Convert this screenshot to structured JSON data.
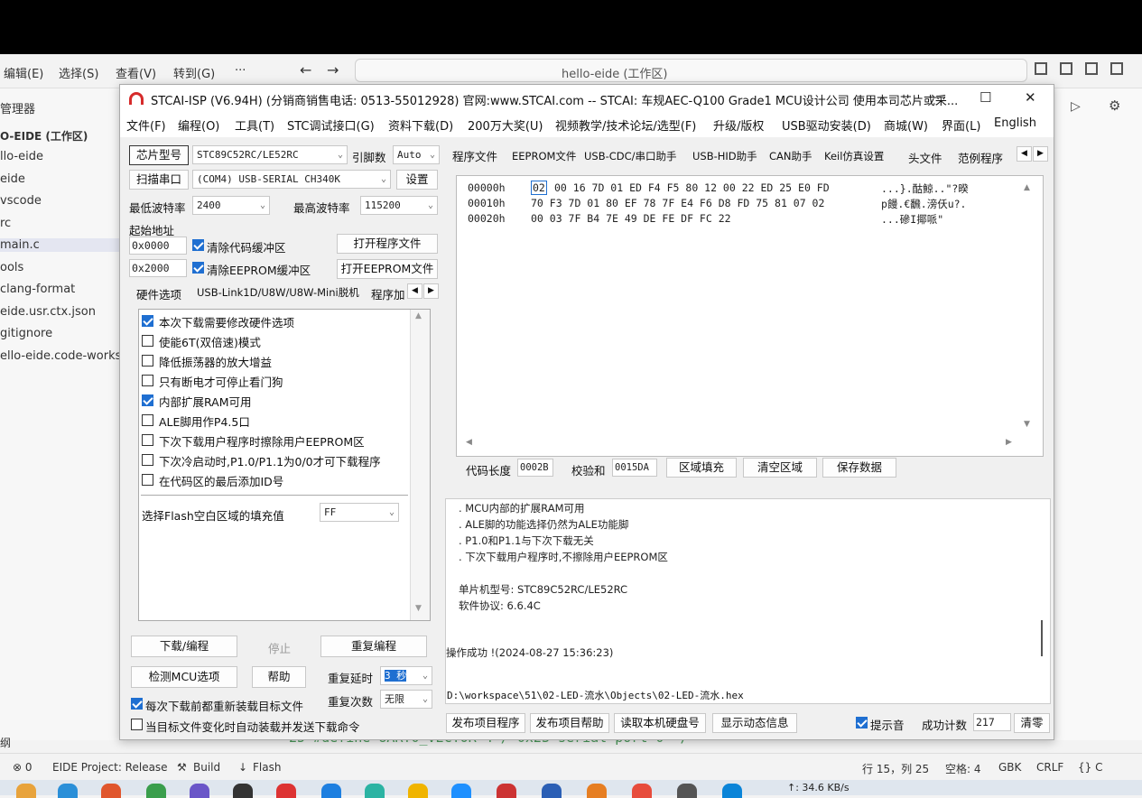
{
  "vscode": {
    "menu": [
      "编辑(E)",
      "选择(S)",
      "查看(V)",
      "转到(G)",
      "···"
    ],
    "nav_back": "←",
    "nav_fwd": "→",
    "search_text": "hello-eide (工作区)",
    "explorer_title": "管理器",
    "explorer_items": [
      "O-EIDE (工作区)",
      "llo-eide",
      "eide",
      "vscode",
      "rc",
      "main.c",
      "ools",
      "clang-format",
      "eide.usr.ctx.json",
      "gitignore",
      "ello-eide.code-works"
    ],
    "explorer_footer": "纲",
    "editor_snippet": "25   #define UART0_VECTOR 4  /  0x23 serial port 0 */",
    "status": {
      "errors": "⊗ 0",
      "project": "EIDE Project: Release",
      "build": "Build",
      "flash": "Flash",
      "position": "行 15，列 25",
      "spaces": "空格: 4",
      "encoding": "GBK",
      "eol": "CRLF",
      "lang": "{} C"
    },
    "taskbar_net": "↑: 34.6 KB/s"
  },
  "isp": {
    "title": "STCAI-ISP (V6.94H) (分销商销售电话: 0513-55012928) 官网:www.STCAI.com  -- STCAI: 车规AEC-Q100 Grade1 MCU设计公司 使用本司芯片或采...",
    "win_min": "—",
    "win_max": "☐",
    "win_close": "✕",
    "menu": [
      "文件(F)",
      "编程(O)",
      "工具(T)",
      "STC调试接口(G)",
      "资料下载(D)",
      "200万大奖(U)",
      "视频教学/技术论坛/选型(F)",
      "升级/版权",
      "USB驱动安装(D)",
      "商城(W)",
      "界面(L)",
      "English"
    ],
    "chip_label": "芯片型号",
    "chip_value": "STC89C52RC/LE52RC",
    "pin_label": "引脚数",
    "pin_value": "Auto",
    "scan_label": "扫描串口",
    "port_value": "(COM4) USB-SERIAL CH340K",
    "settings_btn": "设置",
    "min_baud_label": "最低波特率",
    "min_baud": "2400",
    "max_baud_label": "最高波特率",
    "max_baud": "115200",
    "start_addr_label": "起始地址",
    "addr1": "0x0000",
    "clear_code": "清除代码缓冲区",
    "open_prog": "打开程序文件",
    "addr2": "0x2000",
    "clear_eeprom": "清除EEPROM缓冲区",
    "open_eeprom": "打开EEPROM文件",
    "left_tabs": [
      "硬件选项",
      "USB-Link1D/U8W/U8W-Mini脱机",
      "程序加"
    ],
    "options": [
      {
        "label": "本次下载需要修改硬件选项",
        "checked": true
      },
      {
        "label": "使能6T(双倍速)模式",
        "checked": false
      },
      {
        "label": "降低振荡器的放大增益",
        "checked": false
      },
      {
        "label": "只有断电才可停止看门狗",
        "checked": false
      },
      {
        "label": "内部扩展RAM可用",
        "checked": true
      },
      {
        "label": "ALE脚用作P4.5口",
        "checked": false
      },
      {
        "label": "下次下载用户程序时擦除用户EEPROM区",
        "checked": false
      },
      {
        "label": "下次冷启动时,P1.0/P1.1为0/0才可下载程序",
        "checked": false
      },
      {
        "label": "在代码区的最后添加ID号",
        "checked": false
      }
    ],
    "fill_label": "选择Flash空白区域的填充值",
    "fill_value": "FF",
    "download_btn": "下载/编程",
    "stop_btn": "停止",
    "reprog_btn": "重复编程",
    "detect_btn": "检测MCU选项",
    "help_btn": "帮助",
    "repeat_delay_label": "重复延时",
    "repeat_delay": "3 秒",
    "repeat_count_label": "重复次数",
    "repeat_count": "无限",
    "reload_label": "每次下载前都重新装载目标文件",
    "reload_checked": true,
    "auto_label": "当目标文件变化时自动装载并发送下载命令",
    "auto_checked": false,
    "right_tabs": [
      "程序文件",
      "EEPROM文件",
      "USB-CDC/串口助手",
      "USB-HID助手",
      "CAN助手",
      "Keil仿真设置",
      "头文件",
      "范例程序"
    ],
    "hex_rows": [
      {
        "addr": "00000h",
        "bytes": "00 16 7D 01 ED F4 F5 80 12 00 22 ED 25 E0 FD",
        "first": "02",
        "ascii": "...}.酤鯨..\"?暌"
      },
      {
        "addr": "00010h",
        "bytes": "70 F3 7D 01 80 EF 78 7F E4 F6 D8 FD 75 81 07 02",
        "first": "",
        "ascii": "p饅.€飜.滂仸u?."
      },
      {
        "addr": "00020h",
        "bytes": "00 03 7F B4 7E 49 DE FE DF FC 22",
        "first": "",
        "ascii": "...磣I揶哌\""
      }
    ],
    "code_len_label": "代码长度",
    "code_len": "0002B",
    "checksum_label": "校验和",
    "checksum": "0015DA",
    "fill_area_btn": "区域填充",
    "clear_area_btn": "清空区域",
    "save_btn": "保存数据",
    "log_lines": [
      ". MCU内部的扩展RAM可用",
      ". ALE脚的功能选择仍然为ALE功能脚",
      ". P1.0和P1.1与下次下载无关",
      ". 下次下载用户程序时,不擦除用户EEPROM区",
      "",
      "单片机型号: STC89C52RC/LE52RC",
      "软件协议: 6.6.4C"
    ],
    "op_success": "操作成功 !(2024-08-27 15:36:23)",
    "file_path": "D:\\workspace\\51\\02-LED-流水\\Objects\\02-LED-流水.hex",
    "pub_prog_btn": "发布项目程序",
    "pub_help_btn": "发布项目帮助",
    "read_disk_btn": "读取本机硬盘号",
    "show_info_btn": "显示动态信息",
    "beep_label": "提示音",
    "beep_checked": true,
    "success_count_label": "成功计数",
    "success_count": "217",
    "clear_btn": "清零"
  }
}
